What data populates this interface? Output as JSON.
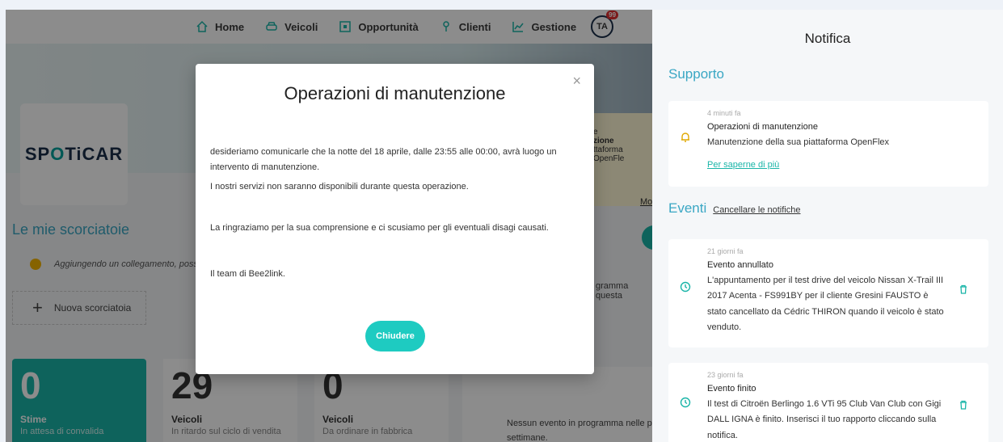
{
  "nav": {
    "items": [
      {
        "label": "Home",
        "icon": "home-icon"
      },
      {
        "label": "Veicoli",
        "icon": "car-icon"
      },
      {
        "label": "Opportunità",
        "icon": "opportunity-icon"
      },
      {
        "label": "Clienti",
        "icon": "client-icon"
      },
      {
        "label": "Gestione",
        "icon": "chart-icon"
      }
    ],
    "avatar": "TA",
    "avatar_badge": "99"
  },
  "logo": {
    "text_before": "SP",
    "text_o": "O",
    "text_after": "TiCAR"
  },
  "shortcuts": {
    "title": "Le mie scorciatoie",
    "hint": "Aggiungendo un collegamento, posso",
    "new_label": "Nuova scorciatoia"
  },
  "stats": [
    {
      "value": "0",
      "label": "Stime",
      "sub": "In attesa di convalida"
    },
    {
      "value": "29",
      "label": "Veicoli",
      "sub": "In ritardo sul ciclo di vendita"
    },
    {
      "value": "0",
      "label": "Veicoli",
      "sub": "Da ordinare in fabbrica"
    }
  ],
  "background_snippets": {
    "events_empty_1": "Nessun evento in programma nelle p",
    "events_empty_2": "settimane.",
    "program_text": "gramma questa",
    "yellow_line1": "e",
    "yellow_line2": "zione",
    "yellow_line3": "ttaforma OpenFle",
    "yellow_more": "Mo"
  },
  "modal": {
    "title": "Operazioni di manutenzione",
    "p1": "desideriamo comunicarle che la notte del 18 aprile, dalle 23:55 alle 00:00, avrà luogo un intervento di manutenzione.",
    "p2": "I nostri servizi non saranno disponibili durante questa operazione.",
    "p3": "La ringraziamo per la sua comprensione e ci scusiamo per gli eventuali disagi causati.",
    "p4": "Il team di Bee2link.",
    "button": "Chiudere",
    "close_symbol": "×"
  },
  "drawer": {
    "title": "Notifica",
    "support": {
      "heading": "Supporto",
      "time": "4 minuti fa",
      "title": "Operazioni di manutenzione",
      "desc": "Manutenzione della sua piattaforma OpenFlex",
      "link": "Per saperne di più"
    },
    "events": {
      "heading": "Eventi",
      "clear": "Cancellare le notifiche",
      "items": [
        {
          "time": "21 giorni fa",
          "title": "Evento annullato",
          "desc": "L'appuntamento per il test drive del veicolo Nissan X-Trail III 2017 Acenta - FS991BY per il cliente Gresini FAUSTO è stato cancellato da Cédric THIRON quando il veicolo è stato venduto."
        },
        {
          "time": "23 giorni fa",
          "title": "Evento finito",
          "desc": "Il test di Citroën Berlingo 1.6 VTi 95 Club Van Club con Gigi DALL IGNA è finito. Inserisci il tuo rapporto cliccando sulla notifica."
        }
      ]
    }
  },
  "colors": {
    "accent": "#1ecbc1",
    "heading": "#3aa7c4",
    "warning_icon": "#e0a800"
  }
}
